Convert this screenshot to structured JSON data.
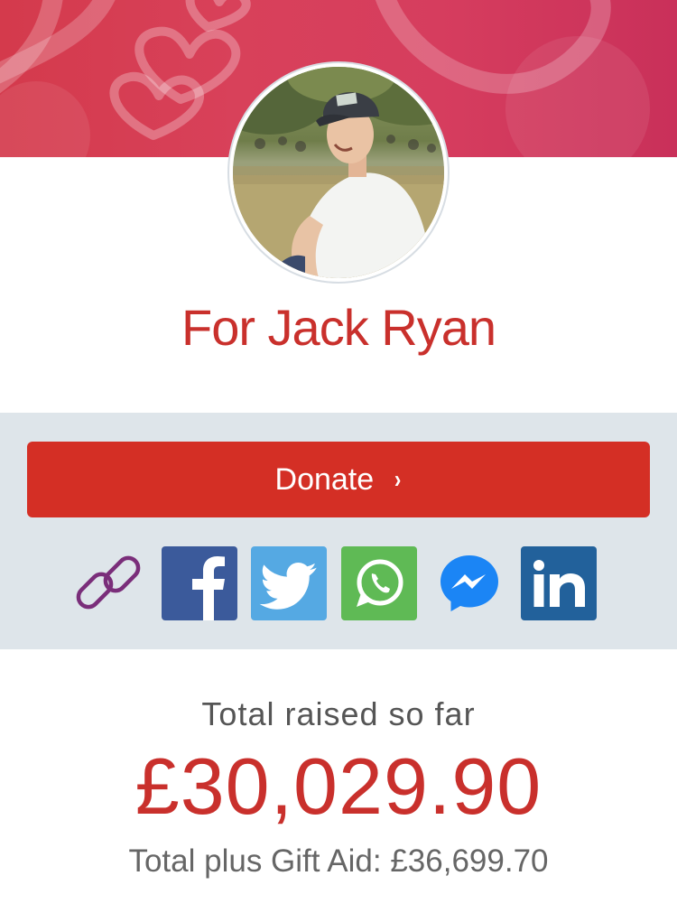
{
  "page": {
    "title": "For Jack Ryan"
  },
  "actions": {
    "donate_label": "Donate",
    "donate_chevron": "›",
    "share_icons": [
      "link-icon",
      "facebook-icon",
      "twitter-icon",
      "whatsapp-icon",
      "messenger-icon",
      "linkedin-icon"
    ]
  },
  "totals": {
    "raised_label": "Total raised so far",
    "raised_amount": "£30,029.90",
    "gift_aid_text": "Total plus Gift Aid: £36,699.70"
  },
  "colors": {
    "brand_red": "#d42f25",
    "title_red": "#c9302c",
    "panel_bg": "#dee5ea",
    "banner_pink": "#d63d5e",
    "facebook": "#3b5a9b",
    "twitter": "#55a9e3",
    "whatsapp": "#5fba55",
    "messenger": "#1b85f5",
    "linkedin": "#22619b",
    "link_purple": "#7a2e7a"
  }
}
